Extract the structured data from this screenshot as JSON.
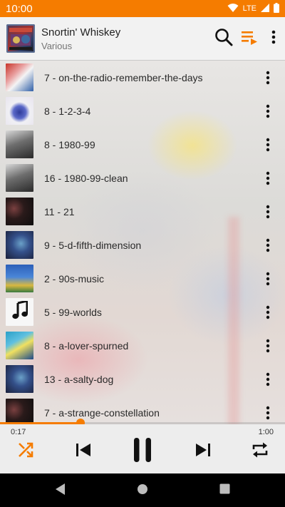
{
  "status_bar": {
    "time": "10:00",
    "network": "LTE"
  },
  "header": {
    "title": "Snortin' Whiskey",
    "subtitle": "Various"
  },
  "tracks": [
    {
      "title": "7 - on-the-radio-remember-the-days",
      "art": "art-1"
    },
    {
      "title": "8 - 1-2-3-4",
      "art": "art-2"
    },
    {
      "title": "8 - 1980-99",
      "art": "art-3"
    },
    {
      "title": "16 - 1980-99-clean",
      "art": "art-3"
    },
    {
      "title": "11 - 21",
      "art": "art-4"
    },
    {
      "title": "9 - 5-d-fifth-dimension",
      "art": "art-5"
    },
    {
      "title": "2 - 90s-music",
      "art": "art-6"
    },
    {
      "title": "5 - 99-worlds",
      "art": "music-note-icon"
    },
    {
      "title": "8 - a-lover-spurned",
      "art": "art-7"
    },
    {
      "title": "13 - a-salty-dog",
      "art": "art-5"
    },
    {
      "title": "7 - a-strange-constellation",
      "art": "art-4"
    }
  ],
  "player": {
    "elapsed": "0:17",
    "total": "1:00",
    "progress": 0.283
  },
  "colors": {
    "accent": "#f57c00",
    "status_bar": "#f57c00",
    "nav_bar": "#000000"
  }
}
